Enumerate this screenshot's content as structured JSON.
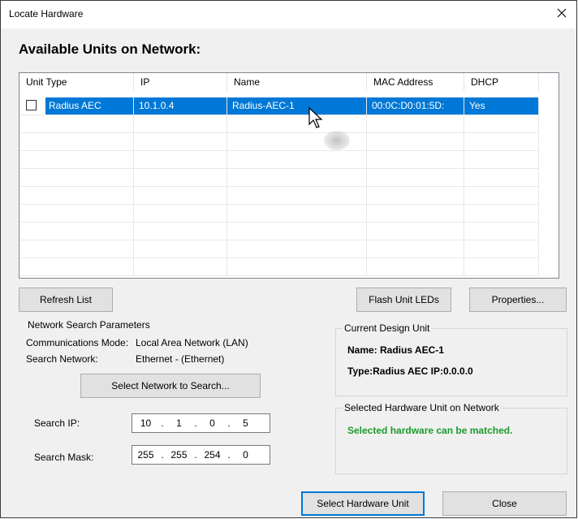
{
  "window": {
    "title": "Locate Hardware"
  },
  "heading": "Available Units on Network:",
  "list": {
    "columns": [
      "Unit Type",
      "IP",
      "Name",
      "MAC Address",
      "DHCP"
    ],
    "rows": [
      {
        "unit_type": "Radius AEC",
        "ip": "10.1.0.4",
        "name": "Radius-AEC-1",
        "mac": "00:0C:D0:01:5D:",
        "dhcp": "Yes",
        "checked": false,
        "selected": true
      }
    ]
  },
  "buttons": {
    "refresh": "Refresh List",
    "flash": "Flash Unit LEDs",
    "properties": "Properties...",
    "select_network": "Select Network to Search...",
    "select_hardware": "Select Hardware Unit",
    "close": "Close"
  },
  "search_params": {
    "legend": "Network Search Parameters",
    "comm_mode_label": "Communications Mode:",
    "comm_mode_value": "Local Area Network (LAN)",
    "network_label": "Search Network:",
    "network_value": "Ethernet -  (Ethernet)",
    "ip_label": "Search IP:",
    "ip_octets": [
      "10",
      "1",
      "0",
      "5"
    ],
    "mask_label": "Search Mask:",
    "mask_octets": [
      "255",
      "255",
      "254",
      "0"
    ]
  },
  "current_unit": {
    "legend": "Current Design Unit",
    "name": "Name: Radius AEC-1",
    "type": "Type:Radius AEC IP:0.0.0.0"
  },
  "selected_unit": {
    "legend": "Selected Hardware Unit on Network",
    "status": "Selected hardware can be matched."
  },
  "colors": {
    "selection": "#0078d7",
    "status_ok": "#1a9a2a"
  }
}
